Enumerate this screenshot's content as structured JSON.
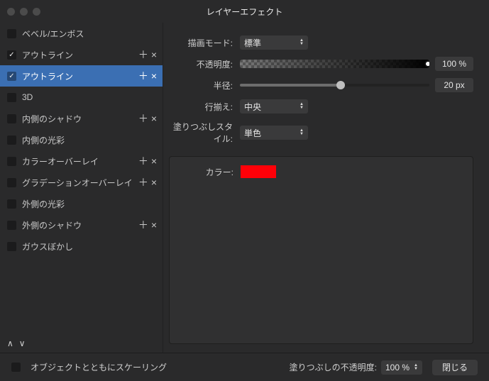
{
  "window": {
    "title": "レイヤーエフェクト"
  },
  "sidebar": {
    "items": [
      {
        "label": "ベベル/エンボス",
        "checked": false,
        "has_add": false,
        "has_remove": false
      },
      {
        "label": "アウトライン",
        "checked": true,
        "has_add": true,
        "has_remove": true
      },
      {
        "label": "アウトライン",
        "checked": true,
        "has_add": true,
        "has_remove": true,
        "selected": true
      },
      {
        "label": "3D",
        "checked": false,
        "has_add": false,
        "has_remove": false
      },
      {
        "label": "内側のシャドウ",
        "checked": false,
        "has_add": true,
        "has_remove": true
      },
      {
        "label": "内側の光彩",
        "checked": false,
        "has_add": false,
        "has_remove": false
      },
      {
        "label": "カラーオーバーレイ",
        "checked": false,
        "has_add": true,
        "has_remove": true
      },
      {
        "label": "グラデーションオーバーレイ",
        "checked": false,
        "has_add": true,
        "has_remove": true
      },
      {
        "label": "外側の光彩",
        "checked": false,
        "has_add": false,
        "has_remove": false
      },
      {
        "label": "外側のシャドウ",
        "checked": false,
        "has_add": true,
        "has_remove": true
      },
      {
        "label": "ガウスぼかし",
        "checked": false,
        "has_add": false,
        "has_remove": false
      }
    ]
  },
  "props": {
    "blend_mode_label": "描画モード:",
    "blend_mode_value": "標準",
    "opacity_label": "不透明度:",
    "opacity_value": "100 %",
    "radius_label": "半径:",
    "radius_value": "20 px",
    "radius_percent": 53,
    "alignment_label": "行揃え:",
    "alignment_value": "中央",
    "fill_style_label": "塗りつぶしスタイル:",
    "fill_style_value": "単色",
    "color_label": "カラー:",
    "color_value": "#ff0008"
  },
  "footer": {
    "scale_with_object_label": "オブジェクトとともにスケーリング",
    "scale_with_object_checked": false,
    "fill_opacity_label": "塗りつぶしの不透明度:",
    "fill_opacity_value": "100 %",
    "close_label": "閉じる"
  }
}
